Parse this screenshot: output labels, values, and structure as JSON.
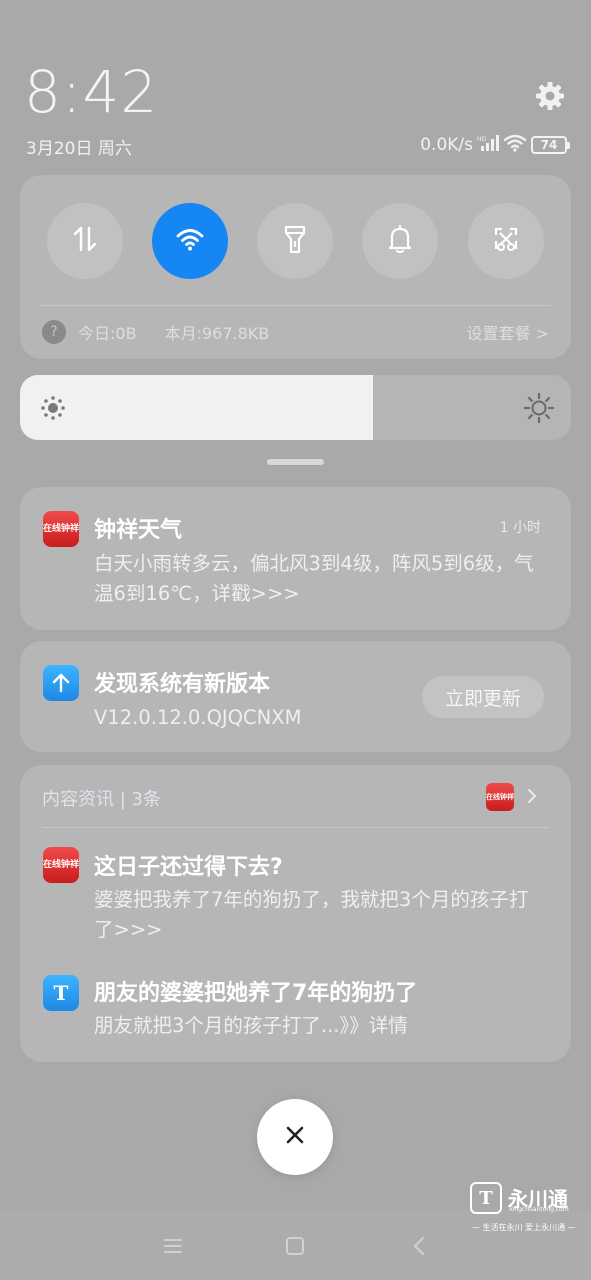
{
  "status": {
    "time": "8:42",
    "date": "3月20日 周六",
    "net_speed": "0.0K/s",
    "battery": "74"
  },
  "quick_settings": {
    "tiles": [
      {
        "name": "mobile-data",
        "icon": "data-transfer-icon",
        "active": false
      },
      {
        "name": "wifi",
        "icon": "wifi-icon",
        "active": true
      },
      {
        "name": "flashlight",
        "icon": "flashlight-icon",
        "active": false
      },
      {
        "name": "sound",
        "icon": "bell-icon",
        "active": false
      },
      {
        "name": "screenshot",
        "icon": "scissors-icon",
        "active": false
      }
    ],
    "usage_today": "今日:0B",
    "usage_month": "本月:967.8KB",
    "set_plan": "设置套餐 >",
    "accent": "#1686f5"
  },
  "brightness": {
    "level": 0.64
  },
  "notifications": {
    "weather": {
      "app_badge": "在线钟祥",
      "title": "钟祥天气",
      "time": "1 小时",
      "body": "白天小雨转多云，偏北风3到4级，阵风5到6级，气温6到16℃，详戳>>>"
    },
    "update": {
      "title": "发现系统有新版本",
      "version": "V12.0.12.0.QJQCNXM",
      "button": "立即更新"
    },
    "news": {
      "header": "内容资讯 | 3条",
      "items": [
        {
          "badge": "在线钟祥",
          "title": "这日子还过得下去?",
          "body": "婆婆把我养了7年的狗扔了，我就把3个月的孩子打了>>>"
        },
        {
          "badge": "T",
          "title": "朋友的婆婆把她养了7年的狗扔了",
          "body": "朋友就把3个月的孩子打了...》》详情"
        }
      ]
    }
  },
  "watermark": {
    "logo": "T",
    "name": "永川通",
    "url": "Tongchuantong.com",
    "slogan": "— 生活在永川  爱上永川通 —"
  }
}
